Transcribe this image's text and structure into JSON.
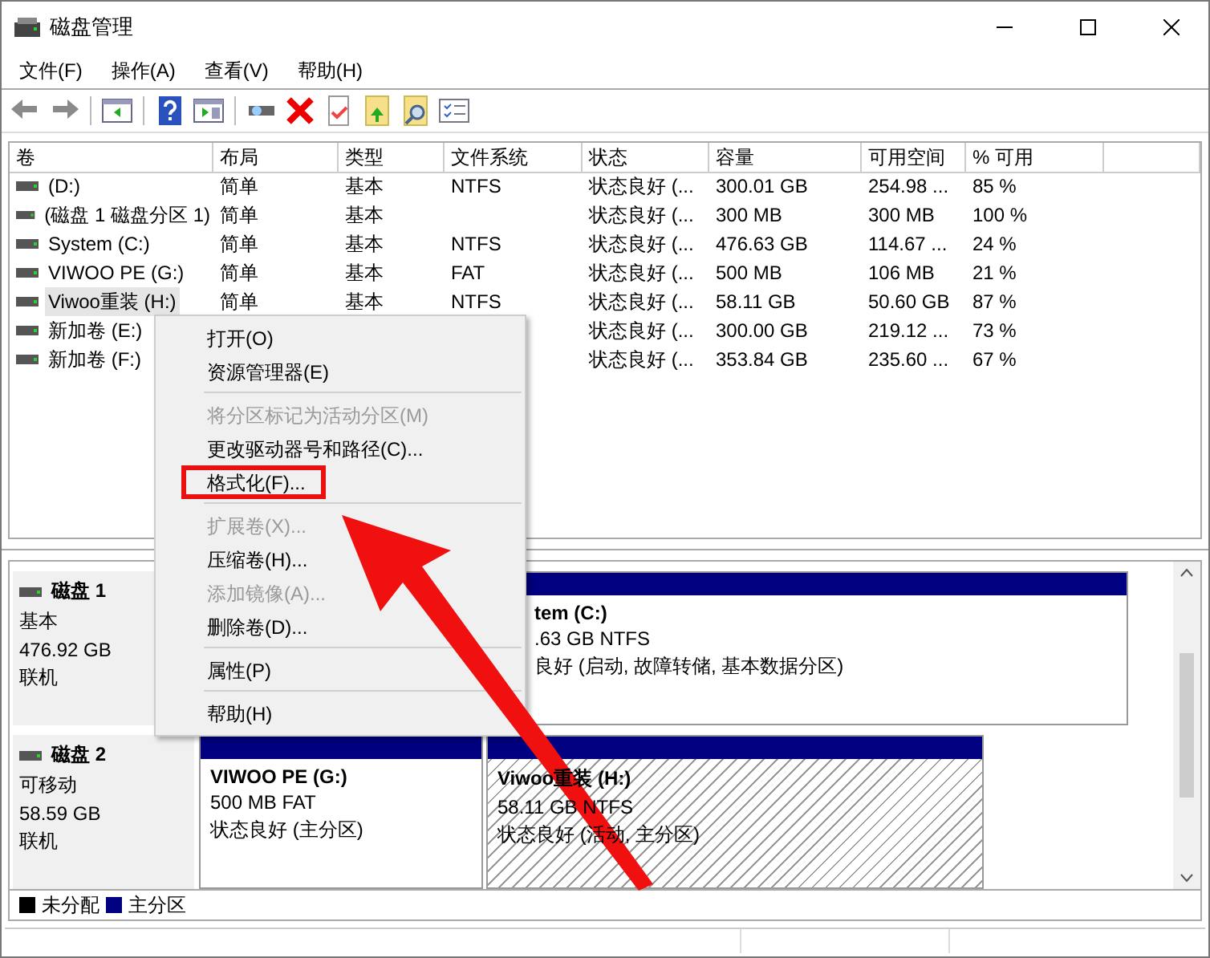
{
  "window": {
    "title": "磁盘管理"
  },
  "menu_bar": [
    "文件(F)",
    "操作(A)",
    "查看(V)",
    "帮助(H)"
  ],
  "table": {
    "columns": [
      "卷",
      "布局",
      "类型",
      "文件系统",
      "状态",
      "容量",
      "可用空间",
      "% 可用"
    ],
    "rows": [
      {
        "selected": false,
        "cells": [
          " (D:)",
          "简单",
          "基本",
          "NTFS",
          "状态良好 (...",
          "300.01 GB",
          "254.98 ...",
          "85 %"
        ]
      },
      {
        "selected": false,
        "cells": [
          "(磁盘 1 磁盘分区 1)",
          "简单",
          "基本",
          null,
          "状态良好 (...",
          "300 MB",
          "300 MB",
          "100 %"
        ]
      },
      {
        "selected": false,
        "cells": [
          "System (C:)",
          "简单",
          "基本",
          "NTFS",
          "状态良好 (...",
          "476.63 GB",
          "114.67 ...",
          "24 %"
        ]
      },
      {
        "selected": false,
        "cells": [
          "VIWOO PE (G:)",
          "简单",
          "基本",
          "FAT",
          "状态良好 (...",
          "500 MB",
          "106 MB",
          "21 %"
        ]
      },
      {
        "selected": true,
        "cells": [
          "Viwoo重装 (H:)",
          "简单",
          "基本",
          "NTFS",
          "状态良好 (...",
          "58.11 GB",
          "50.60 GB",
          "87 %"
        ]
      },
      {
        "selected": false,
        "cells": [
          "新加卷 (E:)",
          null,
          null,
          null,
          "状态良好 (...",
          "300.00 GB",
          "219.12 ...",
          "73 %"
        ]
      },
      {
        "selected": false,
        "cells": [
          "新加卷 (F:)",
          null,
          null,
          null,
          "状态良好 (...",
          "353.84 GB",
          "235.60 ...",
          "67 %"
        ]
      }
    ]
  },
  "disks": [
    {
      "name": "磁盘 1",
      "type": "基本",
      "size": "476.92 GB",
      "status": "联机",
      "hidden_left": true,
      "partitions": [
        {
          "kind": "primary",
          "selected": false,
          "title": "tem (C:)",
          "size": ".63 GB NTFS",
          "status": "良好 (启动, 故障转储, 基本数据分区)"
        }
      ]
    },
    {
      "name": "磁盘 2",
      "type": "可移动",
      "size": "58.59 GB",
      "status": "联机",
      "hidden_left": false,
      "partitions": [
        {
          "kind": "primary",
          "selected": false,
          "title": "VIWOO PE  (G:)",
          "size": "500 MB FAT",
          "status": "状态良好 (主分区)"
        },
        {
          "kind": "primary",
          "selected": true,
          "title": "Viwoo重装  (H:)",
          "size": "58.11 GB NTFS",
          "status": "状态良好 (活动, 主分区)"
        }
      ]
    }
  ],
  "legend": [
    {
      "label": "未分配",
      "color": "#000000"
    },
    {
      "label": "主分区",
      "color": "#000080"
    }
  ],
  "context_menu": {
    "items": [
      {
        "kind": "item",
        "label": "打开(O)",
        "disabled": false,
        "highlighted": false
      },
      {
        "kind": "item",
        "label": "资源管理器(E)",
        "disabled": false,
        "highlighted": false
      },
      {
        "kind": "separator"
      },
      {
        "kind": "item",
        "label": "将分区标记为活动分区(M)",
        "disabled": true,
        "highlighted": false
      },
      {
        "kind": "item",
        "label": "更改驱动器号和路径(C)...",
        "disabled": false,
        "highlighted": false
      },
      {
        "kind": "item",
        "label": "格式化(F)...",
        "disabled": false,
        "highlighted": true
      },
      {
        "kind": "separator"
      },
      {
        "kind": "item",
        "label": "扩展卷(X)...",
        "disabled": true,
        "highlighted": false
      },
      {
        "kind": "item",
        "label": "压缩卷(H)...",
        "disabled": false,
        "highlighted": false
      },
      {
        "kind": "item",
        "label": "添加镜像(A)...",
        "disabled": true,
        "highlighted": false
      },
      {
        "kind": "item",
        "label": "删除卷(D)...",
        "disabled": false,
        "highlighted": false
      },
      {
        "kind": "separator"
      },
      {
        "kind": "item",
        "label": "属性(P)",
        "disabled": false,
        "highlighted": false
      },
      {
        "kind": "separator"
      },
      {
        "kind": "item",
        "label": "帮助(H)",
        "disabled": false,
        "highlighted": false
      }
    ]
  }
}
